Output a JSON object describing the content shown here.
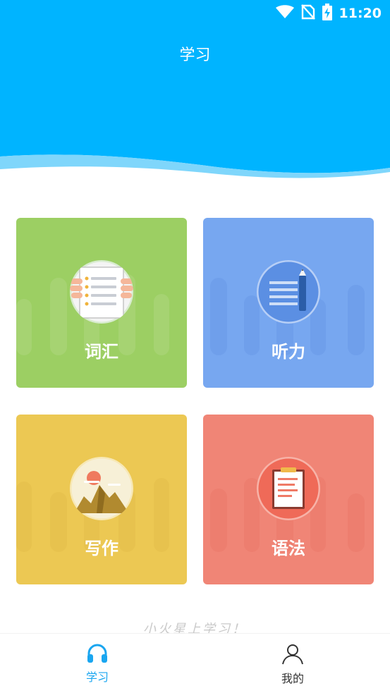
{
  "status_bar": {
    "time": "11:20",
    "icons": [
      "wifi-icon",
      "no-sim-icon",
      "battery-charging-icon"
    ]
  },
  "header": {
    "title": "学习",
    "bg_color": "#00b4ff"
  },
  "cards": [
    {
      "id": "vocab",
      "label": "词汇",
      "color": "#9ccf63",
      "icon": "vocabulary-list-icon"
    },
    {
      "id": "listen",
      "label": "听力",
      "color": "#77a7f0",
      "icon": "notebook-pen-icon"
    },
    {
      "id": "write",
      "label": "写作",
      "color": "#ecc853",
      "icon": "mountain-sunset-icon"
    },
    {
      "id": "grammar",
      "label": "语法",
      "color": "#f08576",
      "icon": "clipboard-icon"
    }
  ],
  "slogan": "小火星上学习！",
  "bottom_nav": {
    "items": [
      {
        "label": "学习",
        "icon": "headphones-icon",
        "active": true
      },
      {
        "label": "我的",
        "icon": "user-icon",
        "active": false
      }
    ],
    "active_color": "#1aa6f0"
  }
}
